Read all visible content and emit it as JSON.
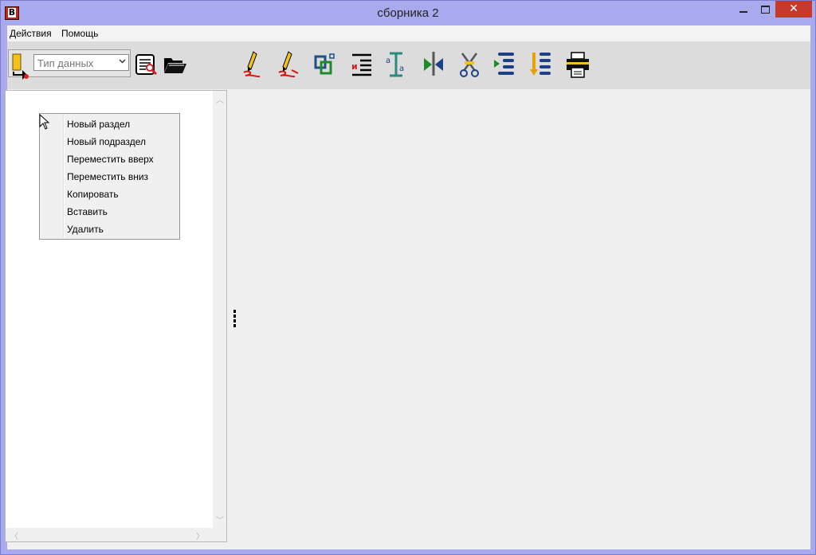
{
  "window": {
    "title": "сборника 2",
    "app_icon_letter": "B",
    "close_glyph": "✕"
  },
  "menubar": {
    "items": [
      "Действия",
      "Помощь"
    ]
  },
  "toolbar": {
    "datatype_select": {
      "value": "Тип данных"
    },
    "tools": [
      "import-icon",
      "preview-icon",
      "open-folder-icon",
      "edit-pencil-icon",
      "edit-pencil-alt-icon",
      "link-icon",
      "numbered-list-icon",
      "text-format-icon",
      "merge-icon",
      "scissors-icon",
      "insert-list-icon",
      "download-list-icon",
      "print-icon"
    ]
  },
  "context_menu": {
    "items": [
      "Новый раздел",
      "Новый подраздел",
      "Переместить вверх",
      "Переместить вниз",
      "Копировать",
      "Вставить",
      "Удалить"
    ]
  },
  "colors": {
    "title_bar": "#a9a9ee",
    "close_button": "#c7392a",
    "toolbar_bg": "#dcdcdc"
  }
}
